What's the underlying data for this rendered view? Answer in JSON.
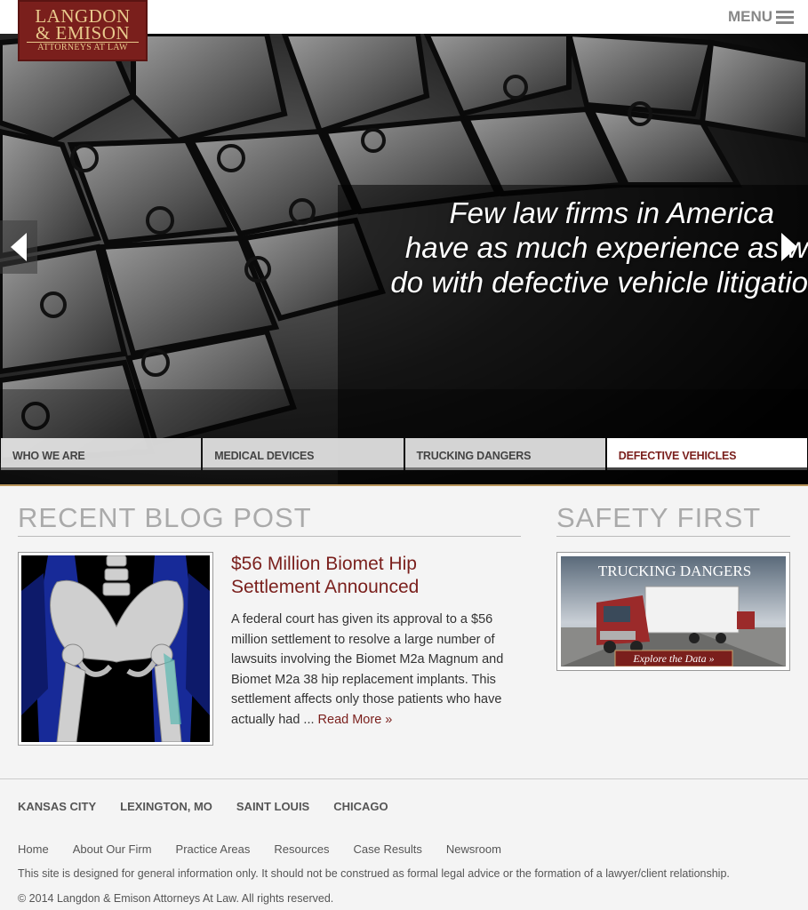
{
  "header": {
    "logo": {
      "line1": "LANGDON",
      "line2": "& EMISON",
      "line3": "ATTORNEYS AT LAW"
    },
    "menu_label": "MENU"
  },
  "hero": {
    "caption": [
      "Few law firms in America",
      "have as much experience as w",
      "do with defective vehicle litigatio"
    ],
    "tabs": [
      {
        "label": "WHO WE ARE",
        "active": false
      },
      {
        "label": "MEDICAL DEVICES",
        "active": false
      },
      {
        "label": "TRUCKING DANGERS",
        "active": false
      },
      {
        "label": "DEFECTIVE VEHICLES",
        "active": true
      }
    ]
  },
  "blog": {
    "heading": "RECENT BLOG POST",
    "post_title": "$56 Million Biomet Hip Settlement Announced",
    "post_body": "A federal court has given its approval to a $56 million settlement to resolve a large number of lawsuits involving the Biomet M2a Magnum and Biomet M2a 38 hip replacement implants.  This settlement affects only those patients who have actually had ...",
    "read_more": "Read More »"
  },
  "safety": {
    "heading": "SAFETY FIRST",
    "card_title": "TRUCKING DANGERS",
    "card_button": "Explore the Data »"
  },
  "footer": {
    "cities": [
      "KANSAS CITY",
      "LEXINGTON, MO",
      "SAINT LOUIS",
      "CHICAGO"
    ],
    "nav": [
      "Home",
      "About Our Firm",
      "Practice Areas",
      "Resources",
      "Case Results",
      "Newsroom"
    ],
    "disclaimer": "This site is designed for general information only. It should not be construed as formal legal advice or the formation of a lawyer/client relationship.",
    "copyright": "© 2014 Langdon & Emison Attorneys At Law. All rights reserved."
  },
  "colors": {
    "brand": "#7a1f1c",
    "accent_gold": "#b8955b",
    "heading_gray": "#aaaaaa"
  }
}
